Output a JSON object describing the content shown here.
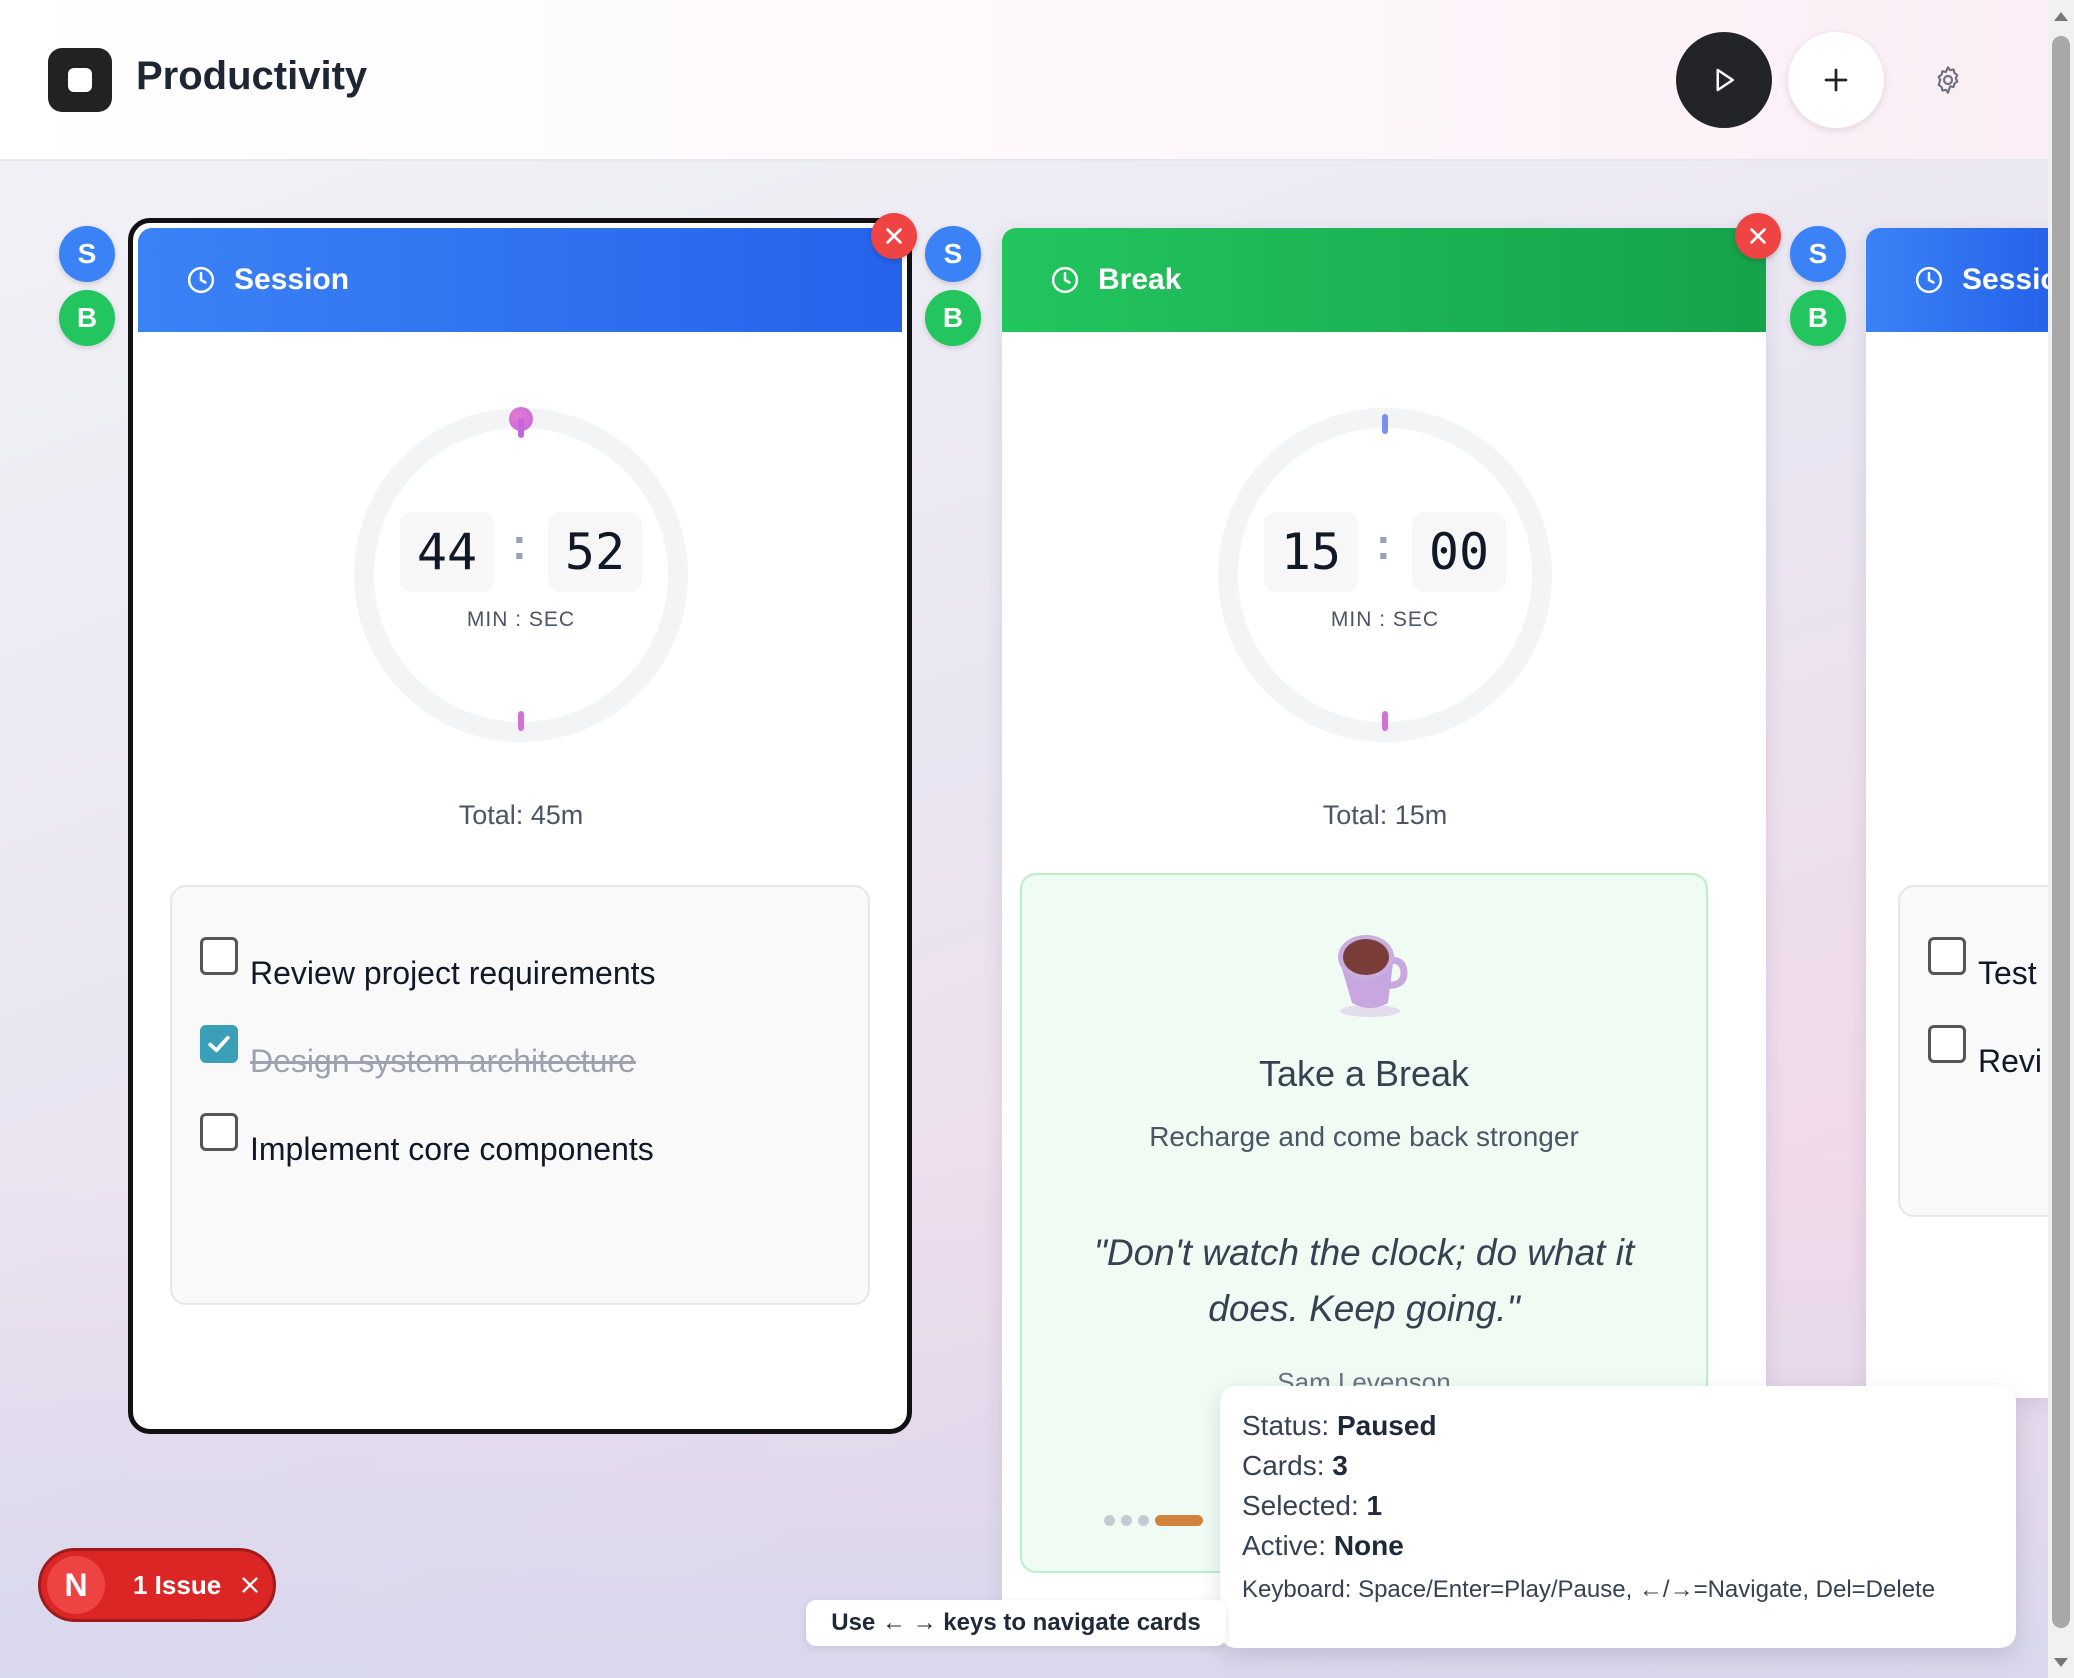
{
  "app": {
    "title": "Productivity"
  },
  "header": {
    "play_icon": "play-icon",
    "add_icon": "plus-icon",
    "settings_icon": "gear-icon"
  },
  "badges": {
    "s": "S",
    "b": "B"
  },
  "cards": [
    {
      "type": "Session",
      "color": "#3b82f6",
      "minutes": "44",
      "seconds": "52",
      "colon": ":",
      "unit_label": "MIN : SEC",
      "total": "Total: 45m",
      "tasks": [
        {
          "label": "Review project requirements",
          "done": false
        },
        {
          "label": "Design system architecture",
          "done": true
        },
        {
          "label": "Implement core components",
          "done": false
        }
      ]
    },
    {
      "type": "Break",
      "color": "#22c55e",
      "minutes": "15",
      "seconds": "00",
      "colon": ":",
      "unit_label": "MIN : SEC",
      "total": "Total: 15m",
      "break_panel": {
        "title": "Take a Break",
        "subtitle": "Recharge and come back stronger",
        "quote": "\"Don't watch the clock; do what it does. Keep going.\"",
        "author": "Sam Levenson"
      }
    },
    {
      "type": "Session",
      "color": "#3b82f6",
      "tasks": [
        {
          "label": "Test",
          "done": false
        },
        {
          "label": "Revi",
          "done": false
        }
      ]
    }
  ],
  "status_panel": {
    "status_label": "Status:",
    "status_value": "Paused",
    "cards_label": "Cards:",
    "cards_value": "3",
    "selected_label": "Selected:",
    "selected_value": "1",
    "active_label": "Active:",
    "active_value": "None",
    "keyboard": "Keyboard: Space/Enter=Play/Pause, ←/→=Navigate, Del=Delete"
  },
  "hint": "Use ← → keys to navigate cards",
  "issue": {
    "letter": "N",
    "label": "1 Issue"
  }
}
